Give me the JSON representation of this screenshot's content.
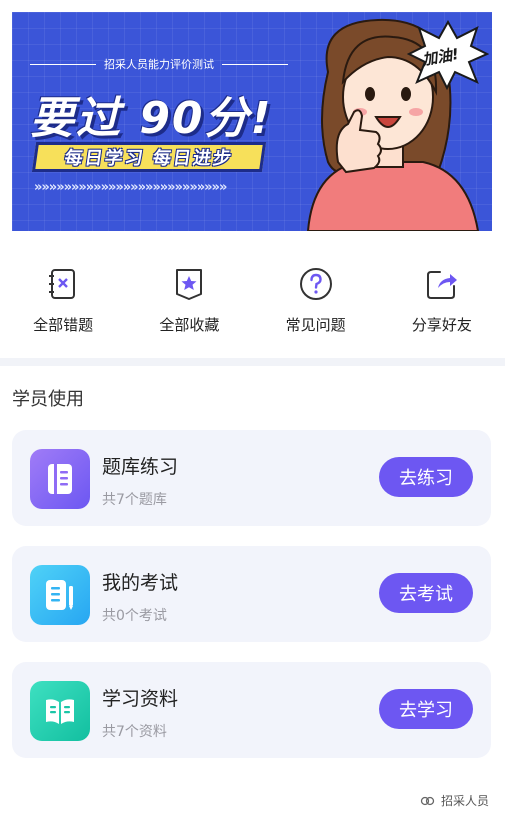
{
  "banner": {
    "subtitle": "招采人员能力评价测试",
    "headline": "要过 90分!",
    "tagline": "每日学习 每日进步",
    "arrows": "»»»»»»»»»»»»»»»»»»»»»»»»»»",
    "burst_text": "加油!",
    "colors": {
      "background": "#3b55d8",
      "tag": "#f7e05a"
    }
  },
  "actions": [
    {
      "label": "全部错题",
      "icon": "wrong-answers-notebook-icon"
    },
    {
      "label": "全部收藏",
      "icon": "favorites-star-icon"
    },
    {
      "label": "常见问题",
      "icon": "question-circle-icon"
    },
    {
      "label": "分享好友",
      "icon": "share-icon"
    }
  ],
  "section": {
    "title": "学员使用"
  },
  "cards": [
    {
      "title": "题库练习",
      "subtitle": "共7个题库",
      "button": "去练习",
      "icon": "book-icon"
    },
    {
      "title": "我的考试",
      "subtitle": "共0个考试",
      "button": "去考试",
      "icon": "exam-paper-icon"
    },
    {
      "title": "学习资料",
      "subtitle": "共7个资料",
      "button": "去学习",
      "icon": "open-book-icon"
    }
  ],
  "footer": {
    "text": "招采人员",
    "icon": "wechat-channel-icon"
  },
  "colors": {
    "accent": "#6d57f2",
    "card_bg": "#f2f4fb"
  }
}
